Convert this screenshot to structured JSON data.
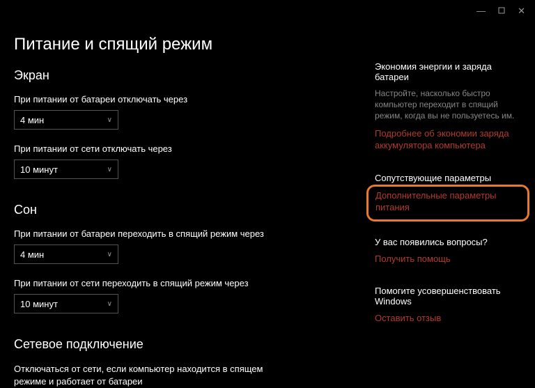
{
  "window": {
    "minimize": "—",
    "maximize_icon": "maximize",
    "close": "✕"
  },
  "page_title": "Питание и спящий режим",
  "screen": {
    "heading": "Экран",
    "battery_label": "При питании от батареи отключать через",
    "battery_value": "4 мин",
    "plugged_label": "При питании от сети отключать через",
    "plugged_value": "10 минут"
  },
  "sleep": {
    "heading": "Сон",
    "battery_label": "При питании от батареи переходить в спящий режим через",
    "battery_value": "4 мин",
    "plugged_label": "При питании от сети переходить в спящий режим через",
    "plugged_value": "10 минут"
  },
  "network": {
    "heading": "Сетевое подключение",
    "desc": "Отключаться от сети, если компьютер находится в спящем режиме и работает от батареи"
  },
  "side": {
    "saving": {
      "heading": "Экономия энергии и заряда батареи",
      "desc": "Настройте, насколько быстро компьютер переходит в спящий режим, когда вы не пользуетесь им.",
      "link": "Подробнее об экономии заряда аккумулятора компьютера"
    },
    "related": {
      "heading": "Сопутствующие параметры",
      "link": "Дополнительные параметры питания"
    },
    "help": {
      "heading": "У вас появились вопросы?",
      "link": "Получить помощь"
    },
    "feedback": {
      "heading": "Помогите усовершенствовать Windows",
      "link": "Оставить отзыв"
    }
  }
}
